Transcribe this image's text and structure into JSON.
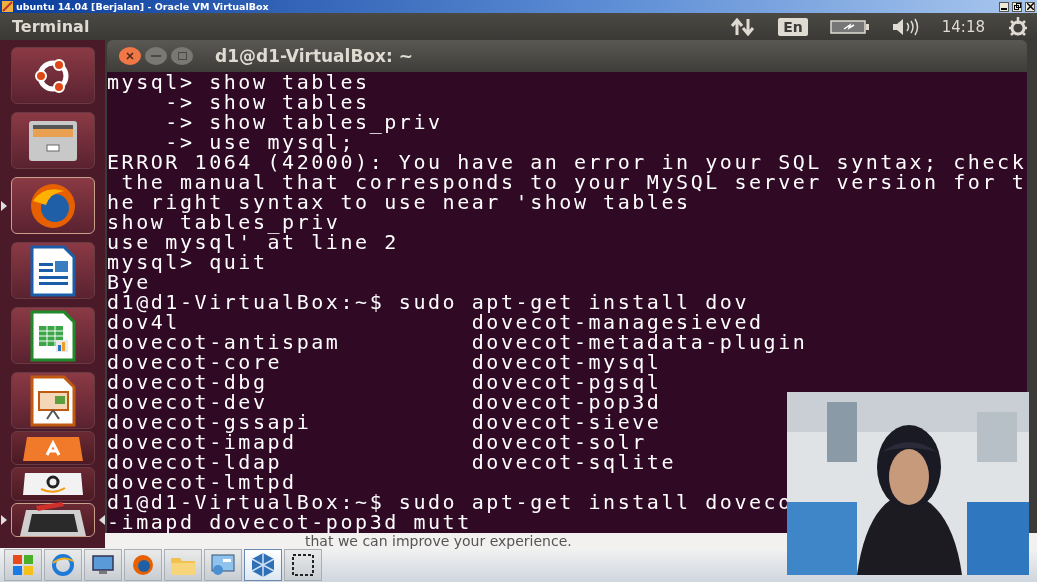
{
  "vbox_window": {
    "title": "ubuntu 14.04 [Berjalan] - Oracle VM VirtualBox"
  },
  "top_panel": {
    "app_name": "Terminal",
    "keyboard_layout": "En",
    "clock": "14:18"
  },
  "launcher": {
    "items": [
      {
        "kind": "dash",
        "running": false
      },
      {
        "kind": "files",
        "running": false
      },
      {
        "kind": "firefox",
        "running": true
      },
      {
        "kind": "writer",
        "running": false
      },
      {
        "kind": "calc",
        "running": false
      },
      {
        "kind": "impress",
        "running": false
      },
      {
        "kind": "software",
        "running": false
      },
      {
        "kind": "amazon",
        "running": false
      },
      {
        "kind": "terminal",
        "running": true
      }
    ]
  },
  "terminal": {
    "title": "d1@d1-VirtualBox: ~",
    "lines": [
      "mysql> show tables",
      "    -> show tables",
      "    -> show tables_priv",
      "    -> use mysql;",
      "ERROR 1064 (42000): You have an error in your SQL syntax; check",
      " the manual that corresponds to your MySQL server version for t",
      "he right syntax to use near 'show tables",
      "show tables_priv",
      "use mysql' at line 2",
      "mysql> quit",
      "Bye",
      "d1@d1-VirtualBox:~$ sudo apt-get install dov",
      "dov4l                    dovecot-managesieved",
      "dovecot-antispam         dovecot-metadata-plugin",
      "dovecot-core             dovecot-mysql",
      "dovecot-dbg              dovecot-pgsql",
      "dovecot-dev              dovecot-pop3d",
      "dovecot-gssapi           dovecot-sieve",
      "dovecot-imapd            dovecot-solr",
      "dovecot-ldap             dovecot-sqlite",
      "dovecot-lmtpd",
      "d1@d1-VirtualBox:~$ sudo apt-get install doveco",
      "-imapd dovecot-pop3d mutt"
    ]
  },
  "background_window": {
    "text": "that we can improve your experience."
  },
  "taskbar": {
    "items": [
      {
        "kind": "start"
      },
      {
        "kind": "ie"
      },
      {
        "kind": "display"
      },
      {
        "kind": "firefox"
      },
      {
        "kind": "folder"
      },
      {
        "kind": "control-panel"
      },
      {
        "kind": "virtualbox",
        "selected": true
      },
      {
        "kind": "snip"
      }
    ]
  }
}
